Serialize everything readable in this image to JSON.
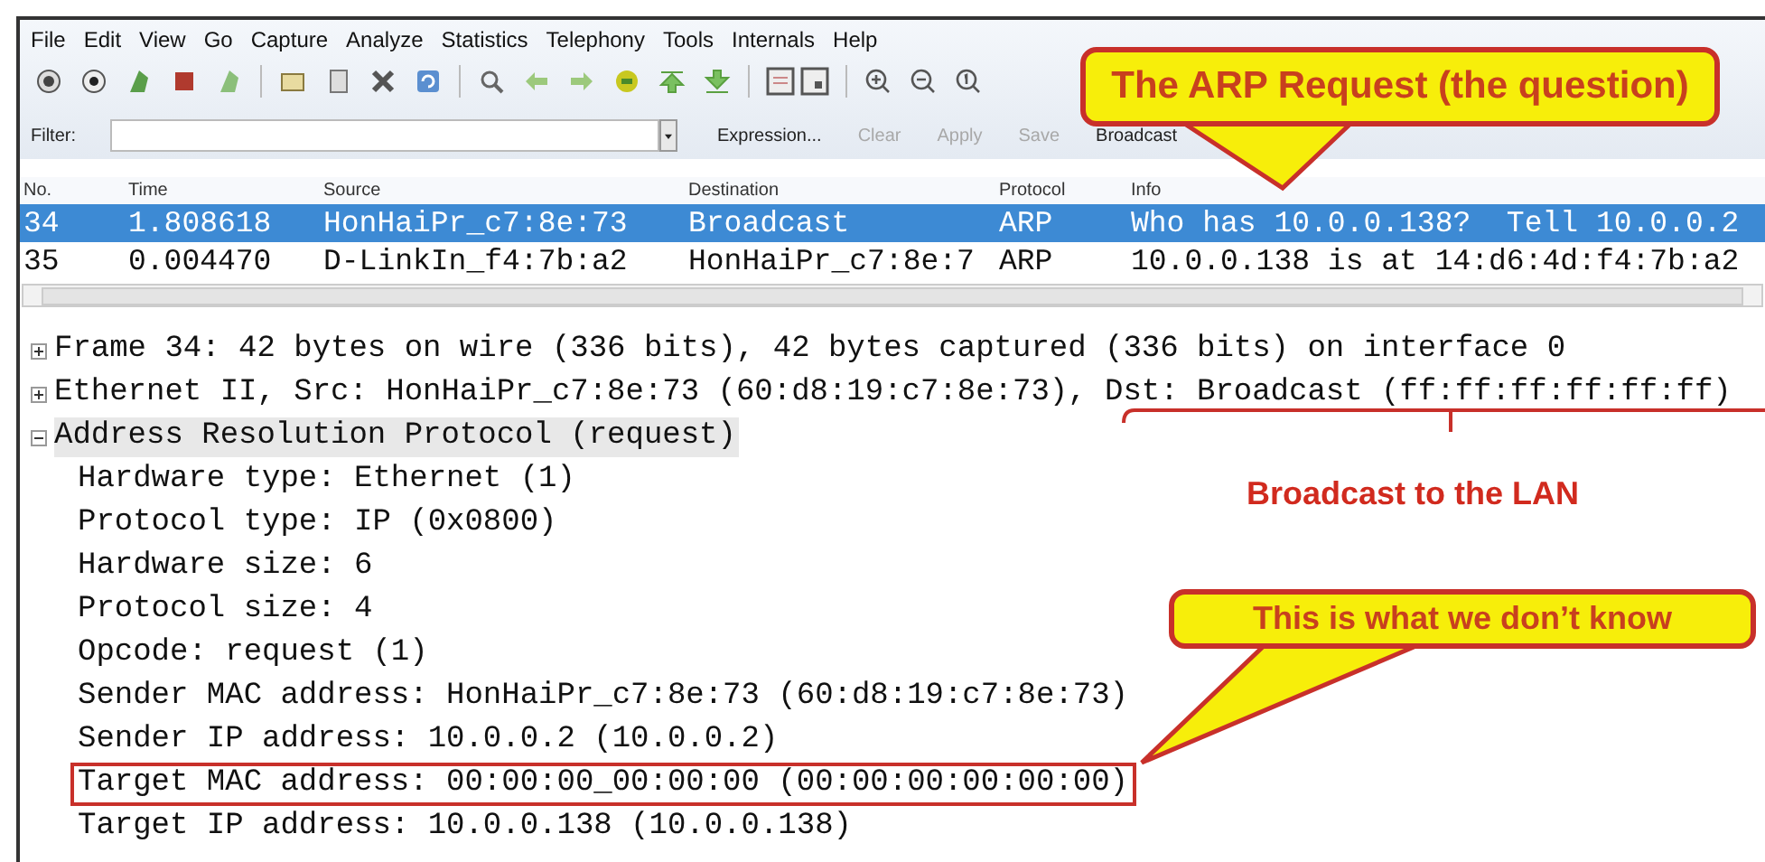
{
  "menu": [
    "File",
    "Edit",
    "View",
    "Go",
    "Capture",
    "Analyze",
    "Statistics",
    "Telephony",
    "Tools",
    "Internals",
    "Help"
  ],
  "filter": {
    "label": "Filter:",
    "buttons": [
      {
        "label": "Expression...",
        "disabled": false
      },
      {
        "label": "Clear",
        "disabled": true
      },
      {
        "label": "Apply",
        "disabled": true
      },
      {
        "label": "Save",
        "disabled": true
      },
      {
        "label": "Broadcast",
        "disabled": false
      }
    ]
  },
  "packet_list": {
    "columns": [
      "No.",
      "Time",
      "Source",
      "Destination",
      "Protocol",
      "Info"
    ],
    "rows": [
      {
        "cells": [
          "34",
          "1.808618",
          "HonHaiPr_c7:8e:73",
          "Broadcast",
          "ARP",
          "Who has 10.0.0.138?  Tell 10.0.0.2"
        ],
        "selected": true
      },
      {
        "cells": [
          "35",
          "0.004470",
          "D-LinkIn_f4:7b:a2",
          "HonHaiPr_c7:8e:7",
          "ARP",
          "10.0.0.138 is at 14:d6:4d:f4:7b:a2"
        ],
        "selected": false
      }
    ]
  },
  "details": [
    {
      "text": "Frame 34: 42 bytes on wire (336 bits), 42 bytes captured (336 bits) on interface 0",
      "expanded": false,
      "selected": false
    },
    {
      "text": "Ethernet II, Src: HonHaiPr_c7:8e:73 (60:d8:19:c7:8e:73), Dst: Broadcast (ff:ff:ff:ff:ff:ff)",
      "expanded": false,
      "selected": false
    },
    {
      "text": "Address Resolution Protocol (request)",
      "expanded": true,
      "selected": true,
      "children": [
        {
          "text": "Hardware type: Ethernet (1)",
          "highlighted": false
        },
        {
          "text": "Protocol type: IP (0x0800)",
          "highlighted": false
        },
        {
          "text": "Hardware size: 6",
          "highlighted": false
        },
        {
          "text": "Protocol size: 4",
          "highlighted": false
        },
        {
          "text": "Opcode: request (1)",
          "highlighted": false
        },
        {
          "text": "Sender MAC address: HonHaiPr_c7:8e:73 (60:d8:19:c7:8e:73)",
          "highlighted": false
        },
        {
          "text": "Sender IP address: 10.0.0.2 (10.0.0.2)",
          "highlighted": false
        },
        {
          "text": "Target MAC address: 00:00:00_00:00:00 (00:00:00:00:00:00)",
          "highlighted": true
        },
        {
          "text": "Target IP address: 10.0.0.138 (10.0.0.138)",
          "highlighted": false
        }
      ]
    }
  ],
  "annotations": [
    {
      "kind": "callout",
      "text": "The ARP Request (the question)"
    },
    {
      "kind": "label",
      "text": "Broadcast to the LAN"
    },
    {
      "kind": "callout",
      "text": "This is what we don’t know"
    }
  ]
}
